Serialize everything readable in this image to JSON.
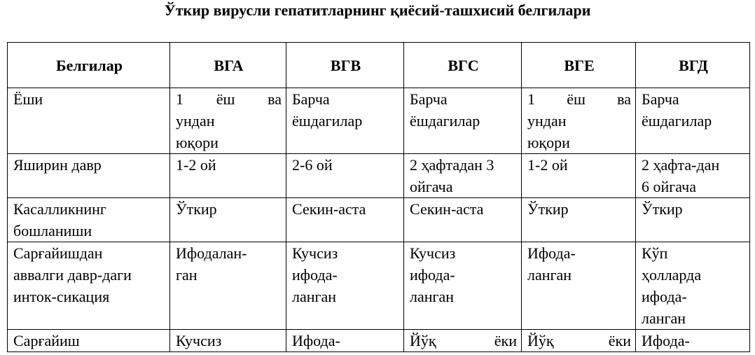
{
  "title": "Ўткир вирусли гепатитларнинг қиёсий-ташхисий белгилари",
  "table": {
    "headers": [
      "Белгилар",
      "ВГА",
      "ВГВ",
      "ВГС",
      "ВГЕ",
      "ВГД"
    ],
    "rows": [
      {
        "cells": [
          [
            "Ёши"
          ],
          [
            "1 ёш ва",
            "ундан",
            "юқори"
          ],
          [
            "Барча",
            "ёшдагилар"
          ],
          [
            "Барча",
            "ёшдагилар"
          ],
          [
            "1 ёш ва",
            "ундан",
            "юқори"
          ],
          [
            "Барча",
            "ёшдагилар"
          ]
        ]
      },
      {
        "cells": [
          [
            "Яширин давр"
          ],
          [
            "1-2 ой"
          ],
          [
            "2-6 ой"
          ],
          [
            "2 ҳафтадан 3",
            "ойгача"
          ],
          [
            "1-2 ой"
          ],
          [
            "2 ҳафта-дан",
            "6 ойгача"
          ]
        ]
      },
      {
        "cells": [
          [
            "Касалликнинг",
            "бошланиши"
          ],
          [
            "Ўткир"
          ],
          [
            "Секин-аста"
          ],
          [
            "Секин-аста"
          ],
          [
            "Ўткир"
          ],
          [
            "Ўткир"
          ]
        ]
      },
      {
        "cells": [
          [
            "Сарғайишдан",
            "аввалги давр-даги",
            "инток-сикация"
          ],
          [
            "Ифодалан-",
            "ган"
          ],
          [
            "Кучсиз",
            "ифода-",
            "ланган"
          ],
          [
            "Кучсиз",
            "ифода-",
            "ланган"
          ],
          [
            "Ифода-",
            "ланган"
          ],
          [
            "Кўп",
            "ҳолларда",
            "ифода-",
            "ланган"
          ]
        ]
      },
      {
        "cells": [
          [
            "Сарғайиш"
          ],
          [
            "Кучсиз"
          ],
          [
            "Ифода-"
          ],
          [
            "Йўқ ёки"
          ],
          [
            "Йўқ ёки"
          ],
          [
            "Ифода-"
          ]
        ]
      }
    ]
  }
}
